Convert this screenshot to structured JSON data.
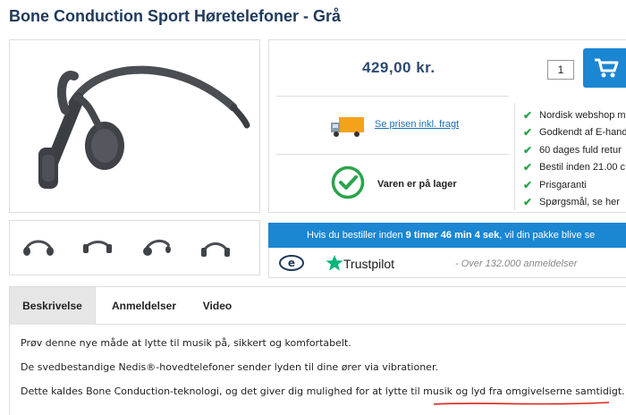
{
  "product": {
    "title": "Bone Conduction Sport Høretelefoner - Grå"
  },
  "purchase": {
    "price": "429,00 kr.",
    "quantity": "1",
    "shipping_link": "Se prisen inkl. fragt",
    "stock_status": "Varen er på lager"
  },
  "usps": [
    "Nordisk webshop m",
    "Godkendt af E-hand",
    "60 dages fuld retur",
    "Bestil inden 21.00 c",
    "Prisgaranti",
    "Spørgsmål, se her"
  ],
  "banner": {
    "prefix": "Hvis du bestiller inden ",
    "countdown": "9 timer 46 min 4 sek",
    "suffix": ", vil din pakke blive se"
  },
  "trust": {
    "trustpilot_label": "Trustpilot",
    "reviews_text": "- Over 132.000 anmeldelser"
  },
  "tabs": [
    {
      "label": "Beskrivelse",
      "active": true
    },
    {
      "label": "Anmeldelser",
      "active": false
    },
    {
      "label": "Video",
      "active": false
    }
  ],
  "description": [
    "Prøv denne nye måde at lytte til musik på, sikkert og komfortabelt.",
    "De svedbestandige Nedis®-hovedtelefoner sender lyden til dine ører via vibrationer.",
    "Dette kaldes Bone Conduction-teknologi, og det giver dig mulighed for at lytte til musik og lyd fra omgivelserne samtidigt."
  ],
  "colors": {
    "title": "#1f3a5c",
    "price": "#2c4a70",
    "accent_blue": "#1b86d2",
    "check_green": "#2aa44a",
    "trustpilot_green": "#00b67a",
    "truck_orange": "#f5a21b",
    "underline_red": "#e0221c"
  },
  "icons": {
    "cart": "shopping-cart-icon",
    "truck": "truck-icon",
    "stock": "check-circle-icon",
    "usp": "check-icon",
    "emark": "e-mark-icon",
    "trustpilot": "trustpilot-star-icon"
  }
}
